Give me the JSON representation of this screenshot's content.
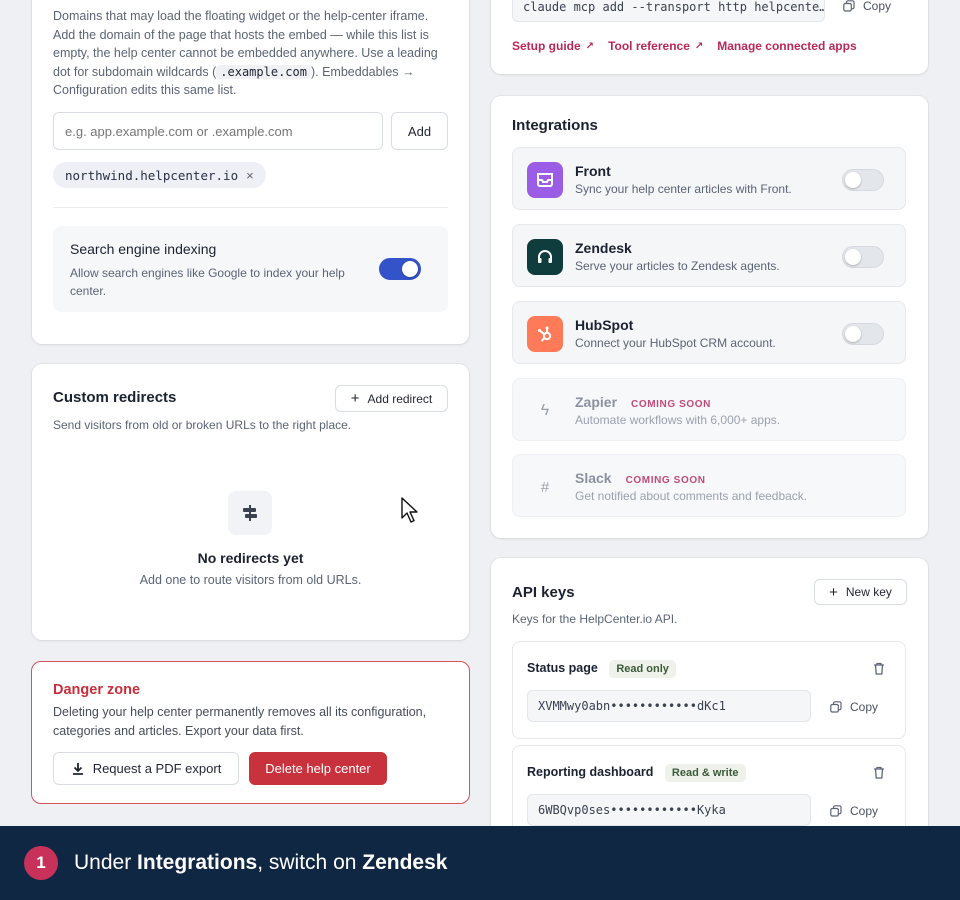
{
  "allowed_domains": {
    "description_parts": [
      "Domains that may load the floating widget or the help-center iframe. Add the domain of the page that hosts the embed — while this list is empty, the help center cannot be embedded anywhere. Use a leading dot for subdomain wildcards (",
      ".example.com",
      "). Embeddables → Configuration edits this same list."
    ],
    "desc_before": "Domains that may load the floating widget or the help-center iframe. Add the domain of the page that hosts the embed — while this list is empty, the help center cannot be embedded anywhere. Use a leading dot for subdomain wildcards (",
    "desc_code": ".example.com",
    "desc_after": "). Embeddables → Configuration edits this same list.",
    "input_placeholder": "e.g. app.example.com or .example.com",
    "add_label": "Add",
    "chips": [
      "northwind.helpcenter.io"
    ],
    "chip_remove": "×"
  },
  "search_indexing": {
    "title": "Search engine indexing",
    "description": "Allow search engines like Google to index your help center.",
    "enabled": true
  },
  "redirects": {
    "title": "Custom redirects",
    "add_label": "Add redirect",
    "description": "Send visitors from old or broken URLs to the right place.",
    "empty_title": "No redirects yet",
    "empty_desc": "Add one to route visitors from old URLs."
  },
  "danger": {
    "title": "Danger zone",
    "description": "Deleting your help center permanently removes all its configuration, categories and articles. Export your data first.",
    "export_label": "Request a PDF export",
    "delete_label": "Delete help center"
  },
  "mcp": {
    "command": "claude mcp add --transport http helpcente…",
    "copy_label": "Copy",
    "links": [
      "Setup guide",
      "Tool reference",
      "Manage connected apps"
    ]
  },
  "integrations": {
    "title": "Integrations",
    "items": [
      {
        "name": "Front",
        "desc": "Sync your help center articles with Front.",
        "enabled": false,
        "color": "#9b5de5"
      },
      {
        "name": "Zendesk",
        "desc": "Serve your articles to Zendesk agents.",
        "enabled": false,
        "color": "#0f3d3e"
      },
      {
        "name": "HubSpot",
        "desc": "Connect your HubSpot CRM account.",
        "enabled": false,
        "color": "#ff7a59"
      },
      {
        "name": "Zapier",
        "desc": "Automate workflows with 6,000+ apps.",
        "soon": "COMING SOON"
      },
      {
        "name": "Slack",
        "desc": "Get notified about comments and feedback.",
        "soon": "COMING SOON"
      }
    ]
  },
  "api_keys": {
    "title": "API keys",
    "new_label": "New key",
    "description": "Keys for the HelpCenter.io API.",
    "keys": [
      {
        "name": "Status page",
        "badge": "Read only",
        "value": "XVMMwy0abn••••••••••••dKc1",
        "copy": "Copy"
      },
      {
        "name": "Reporting dashboard",
        "badge": "Read & write",
        "value": "6WBQvp0ses••••••••••••Kyka",
        "copy": "Copy"
      }
    ]
  },
  "tutorial": {
    "step": "1",
    "text_1": "Under ",
    "bold_1": "Integrations",
    "text_2": ", switch on ",
    "bold_2": "Zendesk"
  }
}
